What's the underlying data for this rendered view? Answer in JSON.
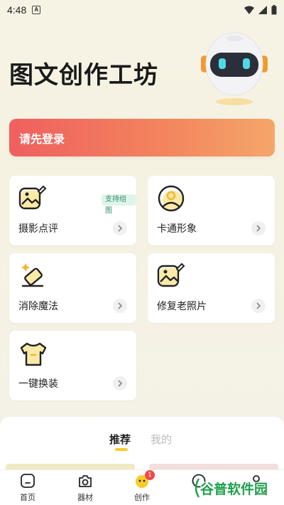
{
  "status_bar": {
    "time": "4:48",
    "notification_letter": "A"
  },
  "header": {
    "title": "图文创作工坊"
  },
  "login_banner": {
    "label": "请先登录"
  },
  "cards": [
    {
      "label": "摄影点评",
      "badge": "支持组图",
      "icon": "photo-review-icon"
    },
    {
      "label": "卡通形象",
      "icon": "cartoon-avatar-icon"
    },
    {
      "label": "消除魔法",
      "icon": "eraser-magic-icon"
    },
    {
      "label": "修复老照片",
      "icon": "restore-photo-icon"
    },
    {
      "label": "一键换装",
      "icon": "outfit-change-icon"
    }
  ],
  "recommend": {
    "tab_active": "推荐",
    "tab_inactive": "我的"
  },
  "bottom_nav": {
    "items": [
      {
        "label": "首页",
        "icon": "home-icon"
      },
      {
        "label": "器材",
        "icon": "camera-icon"
      },
      {
        "label": "创作",
        "icon": "create-icon",
        "badge": "1"
      }
    ]
  },
  "watermark": {
    "text": "谷普软件园"
  },
  "colors": {
    "accent_yellow": "#f6cc2b",
    "banner_start": "#ef5f5f",
    "banner_end": "#f5a66a",
    "badge_green": "#2f8a6a"
  }
}
